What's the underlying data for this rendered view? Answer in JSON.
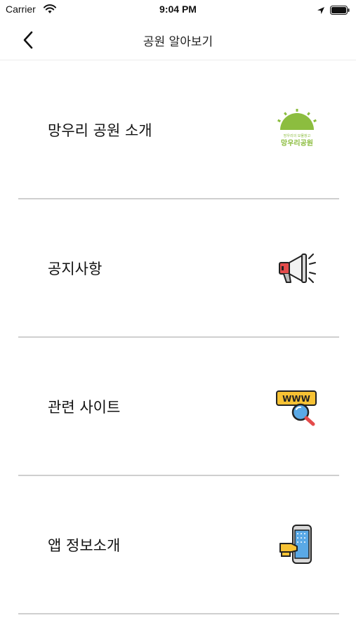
{
  "status_bar": {
    "carrier": "Carrier",
    "time": "9:04 PM"
  },
  "nav": {
    "title": "공원 알아보기",
    "back_icon": "chevron-left-icon"
  },
  "menu": [
    {
      "label": "망우리 공원 소개",
      "icon": "park-logo-icon",
      "logo_text": "망우리공원",
      "logo_tagline": "망우리의 보물창고"
    },
    {
      "label": "공지사항",
      "icon": "megaphone-icon"
    },
    {
      "label": "관련 사이트",
      "icon": "www-search-icon",
      "www_text": "WWW"
    },
    {
      "label": "앱 정보소개",
      "icon": "phone-tap-icon"
    }
  ],
  "colors": {
    "logo_green": "#8cbd3f",
    "divider": "#cfcfcf",
    "accent_yellow": "#f7c234",
    "accent_red": "#e44b4b",
    "accent_blue": "#5aa9e6"
  }
}
